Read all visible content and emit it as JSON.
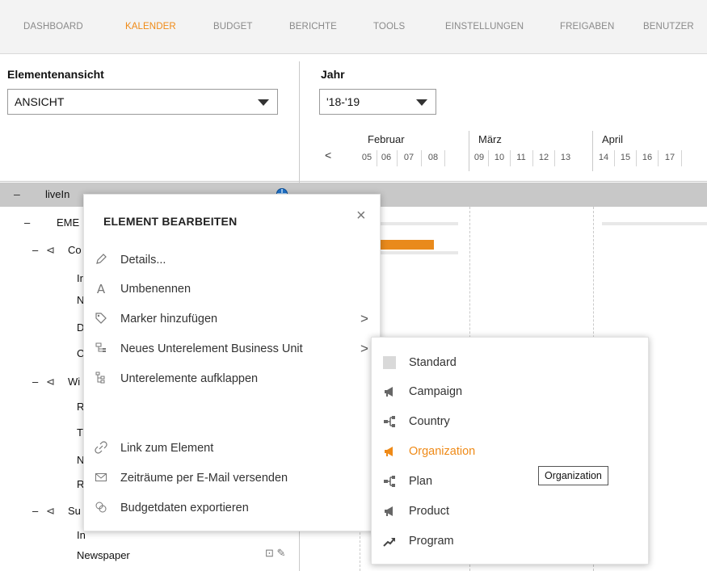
{
  "nav": {
    "tabs": [
      "DASHBOARD",
      "KALENDER",
      "BUDGET",
      "BERICHTE",
      "TOOLS",
      "EINSTELLUNGEN",
      "FREIGABEN",
      "BENUTZER"
    ],
    "active": "KALENDER",
    "accent": "#ef8a17"
  },
  "left_panel": {
    "label": "Elementenansicht",
    "select_value": "ANSICHT"
  },
  "year_panel": {
    "label": "Jahr",
    "select_value": "'18-'19"
  },
  "timeline": {
    "prev": "<",
    "months": [
      "Februar",
      "März",
      "April"
    ],
    "weeks": [
      "05",
      "06",
      "07",
      "08",
      "09",
      "10",
      "11",
      "12",
      "13",
      "14",
      "15",
      "16",
      "17"
    ]
  },
  "tree": {
    "root": {
      "toggle": "–",
      "label": "liveIn",
      "icon": "globe-icon"
    },
    "rows": [
      {
        "toggle": "–",
        "label": "EME"
      },
      {
        "toggle": "–",
        "label": "Co"
      },
      {
        "label": "Ir"
      },
      {
        "label": "N"
      },
      {
        "label": "D"
      },
      {
        "label": "C"
      },
      {
        "toggle": "–",
        "label": "Wi"
      },
      {
        "label": "R"
      },
      {
        "label": "T"
      },
      {
        "label": "N"
      },
      {
        "label": "R"
      },
      {
        "toggle": "–",
        "label": "Su"
      },
      {
        "label": "In"
      },
      {
        "label": "Newspaper"
      }
    ]
  },
  "context_menu": {
    "title": "ELEMENT BEARBEITEN",
    "close": "×",
    "items": [
      {
        "label": "Details...",
        "icon": "pencil-icon"
      },
      {
        "label": "Umbenennen",
        "icon": "rename-icon"
      },
      {
        "label": "Marker hinzufügen",
        "icon": "tag-icon",
        "arrow": ">"
      },
      {
        "label": "Neues Unterelement Business Unit",
        "icon": "hierarchy-add-icon",
        "arrow": ">"
      },
      {
        "label": "Unterelemente aufklappen",
        "icon": "expand-tree-icon"
      },
      {
        "label": "Link zum Element",
        "icon": "link-icon"
      },
      {
        "label": "Zeiträume per E-Mail versenden",
        "icon": "mail-icon"
      },
      {
        "label": "Budgetdaten exportieren",
        "icon": "export-icon"
      }
    ]
  },
  "submenu": {
    "items": [
      {
        "label": "Standard",
        "icon": "square-icon"
      },
      {
        "label": "Campaign",
        "icon": "megaphone-icon"
      },
      {
        "label": "Country",
        "icon": "hierarchy-icon"
      },
      {
        "label": "Organization",
        "icon": "megaphone-icon",
        "highlighted": true
      },
      {
        "label": "Plan",
        "icon": "hierarchy-icon"
      },
      {
        "label": "Product",
        "icon": "megaphone-icon"
      },
      {
        "label": "Program",
        "icon": "trend-icon"
      }
    ]
  },
  "tooltip": "Organization"
}
